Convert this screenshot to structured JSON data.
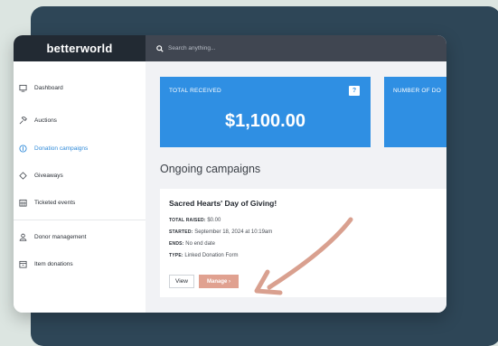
{
  "brand": "betterworld",
  "search": {
    "placeholder": "Search anything..."
  },
  "sidebar": {
    "items": [
      {
        "label": "Dashboard",
        "icon": "monitor-icon"
      },
      {
        "label": "Auctions",
        "icon": "gavel-icon"
      },
      {
        "label": "Donation campaigns",
        "icon": "dollar-circle-icon",
        "active": true
      },
      {
        "label": "Giveaways",
        "icon": "ticket-icon"
      },
      {
        "label": "Ticketed events",
        "icon": "calendar-icon"
      },
      {
        "label": "Donor management",
        "icon": "user-icon"
      },
      {
        "label": "Item donations",
        "icon": "box-icon"
      }
    ]
  },
  "stats": {
    "total_received_label": "TOTAL RECEIVED",
    "total_received_value": "$1,100.00",
    "help": "?",
    "number_of_label": "NUMBER OF DO"
  },
  "main": {
    "section_title": "Ongoing campaigns",
    "campaign": {
      "title": "Sacred Hearts' Day of Giving!",
      "total_raised_key": "TOTAL RAISED:",
      "total_raised_value": "$0.00",
      "started_key": "STARTED:",
      "started_value": "September 18, 2024 at 10:19am",
      "ends_key": "ENDS:",
      "ends_value": "No end date",
      "type_key": "TYPE:",
      "type_value": "Linked Donation Form",
      "view_label": "View",
      "manage_label": "Manage ›"
    }
  },
  "colors": {
    "accent_blue": "#2f8fe3",
    "manage_button": "#e0a190",
    "annotation_arrow": "#d9a08f",
    "backdrop": "#2e4657"
  }
}
